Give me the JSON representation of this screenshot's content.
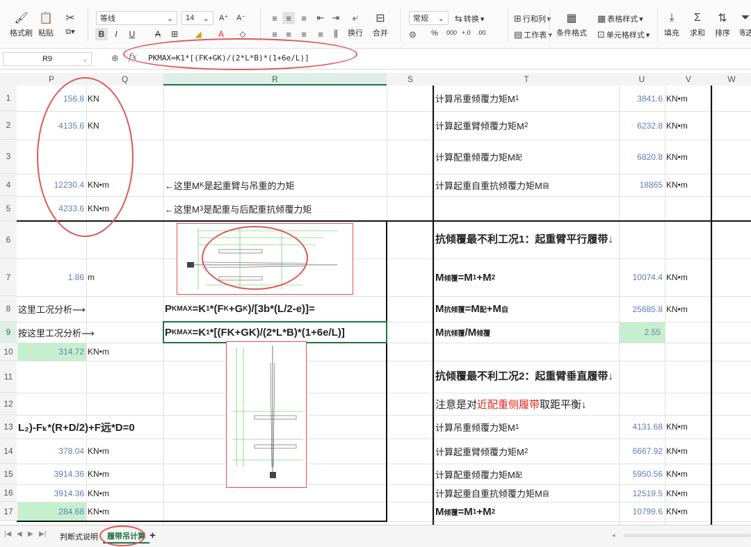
{
  "ribbon": {
    "format_painter": "格式刷",
    "paste": "粘贴",
    "paste_caret": "▾",
    "font_name": "等线",
    "font_size": "14",
    "grow_font": "A⁺",
    "shrink_font": "A⁻",
    "bold": "B",
    "italic": "I",
    "underline": "U",
    "strike": "A",
    "wrap": "换行",
    "merge": "合并",
    "number_format": "常规",
    "convert": "转换",
    "rows_cols": "行和列",
    "worksheet": "工作表",
    "cond_format": "条件格式",
    "table_style": "表格样式",
    "cell_style": "单元格样式",
    "fill": "填充",
    "sum": "求和",
    "sort": "排序",
    "filter": "筛选",
    "percent": "%",
    "thousands": "000",
    "inc_dec": "+.0",
    "dec_dec": ".00"
  },
  "formula_bar": {
    "name_box": "R9",
    "fx": "fx",
    "formula": "PKMAX=K1*[(FK+GK)/(2*L*B)*(1+6e/L)]"
  },
  "columns": [
    "P",
    "Q",
    "R",
    "S",
    "T",
    "U",
    "V",
    "W"
  ],
  "rows": [
    "1",
    "2",
    "3",
    "4",
    "5",
    "6",
    "7",
    "8",
    "9",
    "10",
    "11",
    "12",
    "13",
    "14",
    "15",
    "16",
    "17"
  ],
  "cells": {
    "p1": "156.8",
    "q1": "KN",
    "p2": "4135.6",
    "q2": "KN",
    "p4": "12230.4",
    "q4": "KN•m",
    "p5": "4233.6",
    "q5": "KN•m",
    "p7": "1.86",
    "q7": "m",
    "p8": "这里工况分析⟶",
    "p9": "按这里工况分析⟶",
    "p10": "314.72",
    "q10": "KN•m",
    "p13": "L₂)-Fₖ*(R+D/2)+F远*D=0",
    "p14": "378.04",
    "q14": "KN•m",
    "p15": "3914.36",
    "q15": "KN•m",
    "p16": "3914.36",
    "q16": "KN•m",
    "p17": "284.68",
    "q17": "KN•m",
    "r4a": "←这里M",
    "r4b": "K",
    "r4c": "是起重臂与吊重的力矩",
    "r5a": "←这里M",
    "r5b": "3",
    "r5c": "是配重与后配重抗倾覆力矩",
    "r8": "P",
    "r8s": "KMAX",
    "r8b": "=K",
    "r8c": "1",
    "r8d": "*(F",
    "r8e": "K",
    "r8f": "+G",
    "r8g": "K",
    "r8h": ")/[3b*(L/2-e)]=",
    "r9": "P",
    "r9s": "KMAX",
    "r9b": "=K",
    "r9c": "1",
    "r9d": "*[(FK+GK)/(2*L*B)*(1+6e/L)]",
    "t1": "计算吊重倾覆力矩M",
    "t1s": "1",
    "t2": "计算起重臂倾覆力矩M",
    "t2s": "2",
    "t3": "计算配重倾覆力矩M",
    "t3s": "配",
    "t4": "计算起重自重抗倾覆力矩M",
    "t4s": "自",
    "t6": "抗倾覆最不利工况1：起重臂平行履带↓",
    "t7a": "M",
    "t7s": "倾覆",
    "t7b": "=M",
    "t7c": "1",
    "t7d": "+M",
    "t7e": "2",
    "t8a": "M",
    "t8s": "抗倾覆",
    "t8b": "=M",
    "t8c": "配",
    "t8d": "+M",
    "t8e": "自",
    "t9a": "M",
    "t9s": "抗倾覆",
    "t9b": "/M",
    "t9c": "倾覆",
    "t11": "抗倾覆最不利工况2：起重臂垂直履带↓",
    "t12a": "注意是对",
    "t12b": "近配重侧履带",
    "t12c": "取距平衡↓",
    "t13": "计算吊重倾覆力矩M",
    "t13s": "1",
    "t14": "计算起重臂倾覆力矩M",
    "t14s": "2",
    "t15": "计算配重倾覆力矩M",
    "t15s": "配",
    "t16": "计算起重自重抗倾覆力矩M",
    "t16s": "自",
    "t17a": "M",
    "t17s": "倾覆",
    "t17b": "=M",
    "t17c": "1",
    "t17d": "+M",
    "t17e": "2",
    "u1": "3841.6",
    "v1": "KN•m",
    "u2": "6232.8",
    "v2": "KN•m",
    "u3": "6820.8",
    "v3": "KN•m",
    "u4": "18865",
    "v4": "KN•m",
    "u7": "10074.4",
    "v7": "KN•m",
    "u8": "25685.8",
    "v8": "KN•m",
    "u9": "2.55",
    "u13": "4131.68",
    "v13": "KN•m",
    "u14": "6667.92",
    "v14": "KN•m",
    "u15": "5950.56",
    "v15": "KN•m",
    "u16": "12519.5",
    "v16": "KN•m",
    "u17": "10799.6",
    "v17": "KN•m"
  },
  "sheet_tabs": [
    "判断式说明",
    "履带吊计算"
  ],
  "add_sheet": "+",
  "colors": {
    "accent": "#1e7145",
    "number_blue": "#5b7fb8",
    "highlight_green": "#c6efce",
    "annotation_red": "#e05555"
  }
}
